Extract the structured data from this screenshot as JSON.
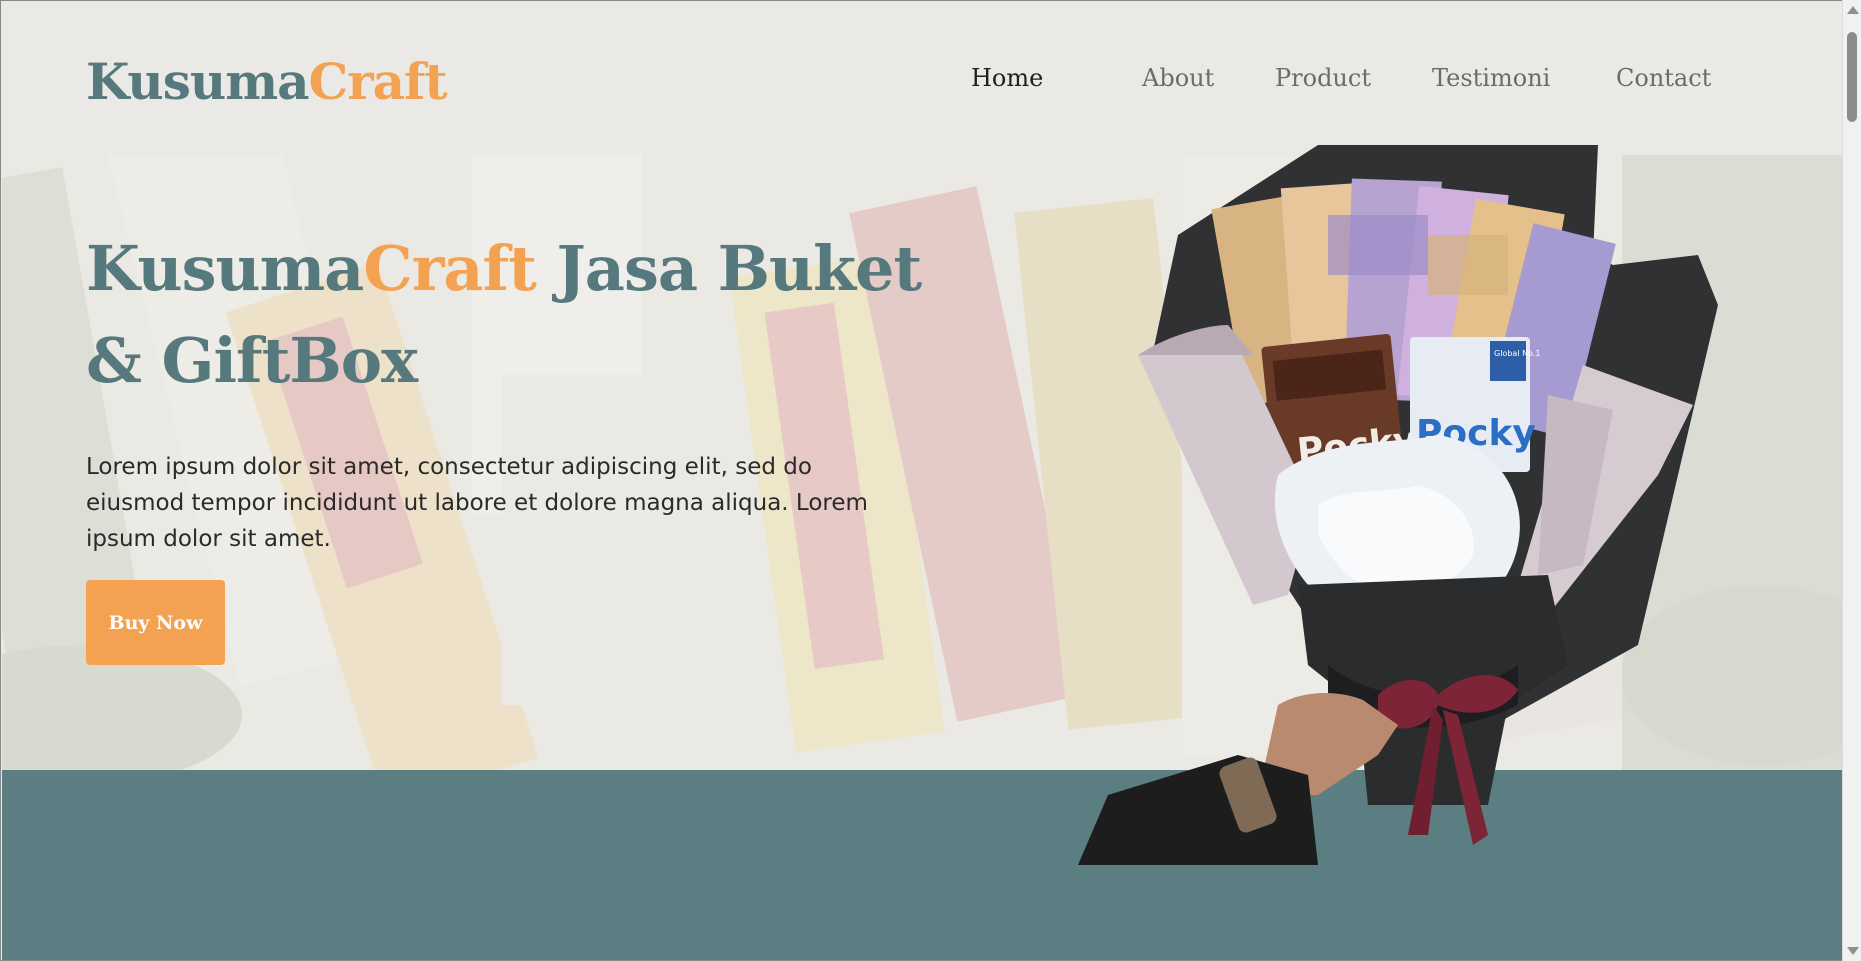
{
  "header": {
    "logo_primary": "Kusuma",
    "logo_accent": "Craft",
    "nav": [
      {
        "label": "Home",
        "active": true
      },
      {
        "label": "About",
        "active": false
      },
      {
        "label": "Product",
        "active": false
      },
      {
        "label": "Testimoni",
        "active": false
      },
      {
        "label": "Contact",
        "active": false
      }
    ]
  },
  "hero": {
    "title_primary": "Kusuma",
    "title_accent": "Craft",
    "title_rest": " Jasa Buket & GiftBox",
    "description": "Lorem ipsum dolor sit amet, consectetur adipiscing elit, sed do eiusmod tempor incididunt ut labore et dolore magna aliqua. Lorem ipsum dolor sit amet.",
    "cta_label": "Buy Now",
    "image": {
      "icon": "money-snack-bouquet-image",
      "package_labels": [
        "Pocky",
        "Pocky"
      ],
      "badge": "Global No.1"
    }
  },
  "colors": {
    "brand": "#56797d",
    "accent": "#f3a251",
    "band": "#5a7e82",
    "background": "#ebe9e5"
  }
}
